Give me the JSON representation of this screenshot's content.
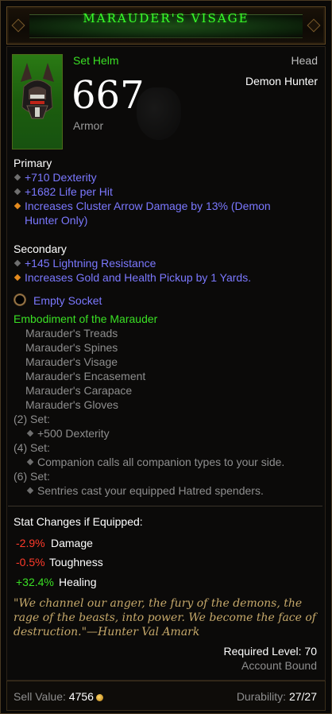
{
  "item": {
    "name": "MARAUDER'S VISAGE",
    "type": "Set Helm",
    "slot": "Head",
    "class": "Demon Hunter",
    "armor_value": "667",
    "armor_label": "Armor"
  },
  "primary": {
    "heading": "Primary",
    "stats": [
      "+710 Dexterity",
      "+1682 Life per Hit"
    ],
    "special_line1": "Increases Cluster Arrow Damage by 13% (Demon",
    "special_line2": "Hunter Only)"
  },
  "secondary": {
    "heading": "Secondary",
    "stats": [
      "+145 Lightning Resistance"
    ],
    "special": "Increases Gold and Health Pickup by 1 Yards."
  },
  "socket_label": "Empty Socket",
  "set": {
    "name": "Embodiment of the Marauder",
    "pieces": [
      "Marauder's Treads",
      "Marauder's Spines",
      "Marauder's Visage",
      "Marauder's Encasement",
      "Marauder's Carapace",
      "Marauder's Gloves"
    ],
    "bonus2_label": "(2) Set:",
    "bonus2": "+500 Dexterity",
    "bonus4_label": "(4) Set:",
    "bonus4": "Companion calls all companion types to your side.",
    "bonus6_label": "(6) Set:",
    "bonus6": "Sentries cast your equipped Hatred spenders."
  },
  "stat_changes": {
    "heading": "Stat Changes if Equipped:",
    "rows": [
      {
        "value": "-2.9%",
        "label": "Damage"
      },
      {
        "value": "-0.5%",
        "label": "Toughness"
      },
      {
        "value": "+32.4%",
        "label": "Healing"
      }
    ]
  },
  "flavor": {
    "line1": "\"We channel our anger, the fury of the demons, the",
    "line2": "rage of the beasts, into power. We become the face of",
    "line3": "destruction.\"—Hunter Val Amark"
  },
  "required_level": "Required Level: 70",
  "binding": "Account Bound",
  "footer": {
    "sell_label": "Sell Value:",
    "sell_value": "4756",
    "durability_label": "Durability:",
    "durability_value": "27/27"
  },
  "colors": {
    "set_green": "#3ae024",
    "magic_blue": "#7b78ff",
    "legendary_orange": "#e38a1e",
    "negative_red": "#ff3a2a",
    "flavor_gold": "#c5a86a"
  }
}
